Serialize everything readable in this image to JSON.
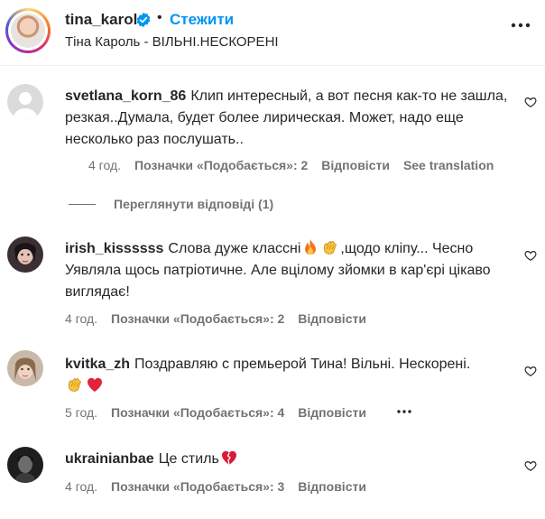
{
  "header": {
    "username": "tina_karol",
    "follow_label": "Стежити",
    "separator": "•",
    "subtitle": "Тіна Кароль - ВІЛЬНІ.НЕСКОРЕНІ",
    "more_icon": "more-horizontal-icon"
  },
  "comments": [
    {
      "username": "svetlana_korn_86",
      "text": "Клип интересный, а вот песня как-то не зашла, резкая..Думала, будет более лирическая. Может, надо еще несколько раз послушать..",
      "time": "4 год.",
      "likes_label": "Позначки «Подобається»: 2",
      "reply_label": "Відповісти",
      "translate_label": "See translation",
      "view_replies_label": "Переглянути відповіді (1)"
    },
    {
      "username": "irish_kissssss",
      "text_before": "Слова дуже классні",
      "text_after": ",щодо кліпу... Чесно Уявляла щось патріотичне. Але вцілому зйомки в кар'єрі цікаво виглядає!",
      "emojis": [
        "fire-emoji",
        "clapping-hands-emoji"
      ],
      "time": "4 год.",
      "likes_label": "Позначки «Подобається»: 2",
      "reply_label": "Відповісти"
    },
    {
      "username": "kvitka_zh",
      "text": "Поздравляю с премьерой Тина! Вільні. Нескорені.",
      "emojis": [
        "clapping-hands-emoji",
        "red-heart-emoji"
      ],
      "time": "5 год.",
      "likes_label": "Позначки «Подобається»: 4",
      "reply_label": "Відповісти"
    },
    {
      "username": "ukrainianbae",
      "text": "Це стиль",
      "emojis": [
        "broken-heart-emoji"
      ],
      "time": "4 год.",
      "likes_label": "Позначки «Подобається»: 3",
      "reply_label": "Відповісти"
    }
  ],
  "colors": {
    "link_blue": "#0095f6",
    "secondary_text": "#737373",
    "primary_text": "#262626"
  }
}
